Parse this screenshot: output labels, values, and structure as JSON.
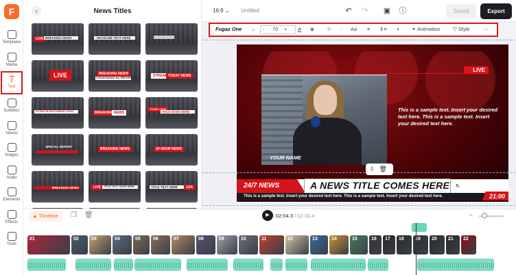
{
  "rail": {
    "items": [
      {
        "label": "Templates",
        "icon": "templates-icon"
      },
      {
        "label": "Media",
        "icon": "media-icon"
      },
      {
        "label": "Text",
        "icon": "text-icon",
        "active": true
      },
      {
        "label": "Subtitles",
        "icon": "subtitles-icon"
      },
      {
        "label": "Videos",
        "icon": "videos-icon"
      },
      {
        "label": "Images",
        "icon": "images-icon"
      },
      {
        "label": "Audio",
        "icon": "audio-icon"
      },
      {
        "label": "Elements",
        "icon": "elements-icon"
      },
      {
        "label": "Effects",
        "icon": "effects-icon"
      },
      {
        "label": "Tools",
        "icon": "tools-icon"
      }
    ]
  },
  "panel": {
    "title": "News Titles",
    "thumbs": [
      {
        "tag": "LIVE",
        "text": "BREAKING NEWS"
      },
      {
        "tag": "",
        "text": "HEADLINE TEXT HERE"
      },
      {
        "tag": "",
        "text": ""
      },
      {
        "tag": "LIVE",
        "text": ""
      },
      {
        "tag": "BREAKING NEWS",
        "text": "LOGAN DOUGLAS, REPORTER"
      },
      {
        "tag": "STREAM",
        "text": "TODAY NEWS"
      },
      {
        "tag": "",
        "text": "VOTING IN 2023 DURING COVID"
      },
      {
        "tag": "BREAKING",
        "text": "NEWS"
      },
      {
        "tag": "YOUR LOGO",
        "text": "TITLE GOES HERE"
      },
      {
        "tag": "SPECIAL REPORT",
        "text": ""
      },
      {
        "tag": "BREAKING NEWS",
        "text": ""
      },
      {
        "tag": "24 HOUR NEWS",
        "text": ""
      },
      {
        "tag": "",
        "text": "BREAKING NEWS"
      },
      {
        "tag": "LIVE",
        "text": "TITLE TEXT GOES HERE"
      },
      {
        "tag": "1/24",
        "text": "TITLE TEXT HERE"
      }
    ]
  },
  "topbar": {
    "ratio": "16:9",
    "project": "Untitled",
    "saved": "Saved",
    "export": "Export"
  },
  "text_toolbar": {
    "font": "Fugaz One",
    "size": "70",
    "minus": "-",
    "plus": "+",
    "animation": "Animation",
    "style": "Style"
  },
  "canvas": {
    "live": "LIVE",
    "sample_right": "This is a sample text. Insert your desired text here. This is a sample text. Insert your desired text here.",
    "your_name": "YOUR NAME",
    "news_tag": "24/7 NEWS",
    "headline": "A NEWS TITLE COMES HERE",
    "ticker": "This is a sample text. Insert your desired text here. This is a sample text. Insert your desired text here.",
    "clock": "21:00"
  },
  "timeline": {
    "label": "Timeline",
    "current": "02:04.3",
    "total": "/ 02:30.4",
    "clips": [
      "01",
      "02",
      "03",
      "04",
      "05",
      "06",
      "07",
      "08",
      "09",
      "10",
      "11",
      "12",
      "13",
      "14",
      "15",
      "16",
      "17",
      "18",
      "19",
      "20",
      "21",
      "22"
    ]
  },
  "colors": {
    "accent": "#ff5a1f",
    "highlight": "#d61a1a",
    "news_red": "#d4141a",
    "audio": "#7fdcc2"
  }
}
